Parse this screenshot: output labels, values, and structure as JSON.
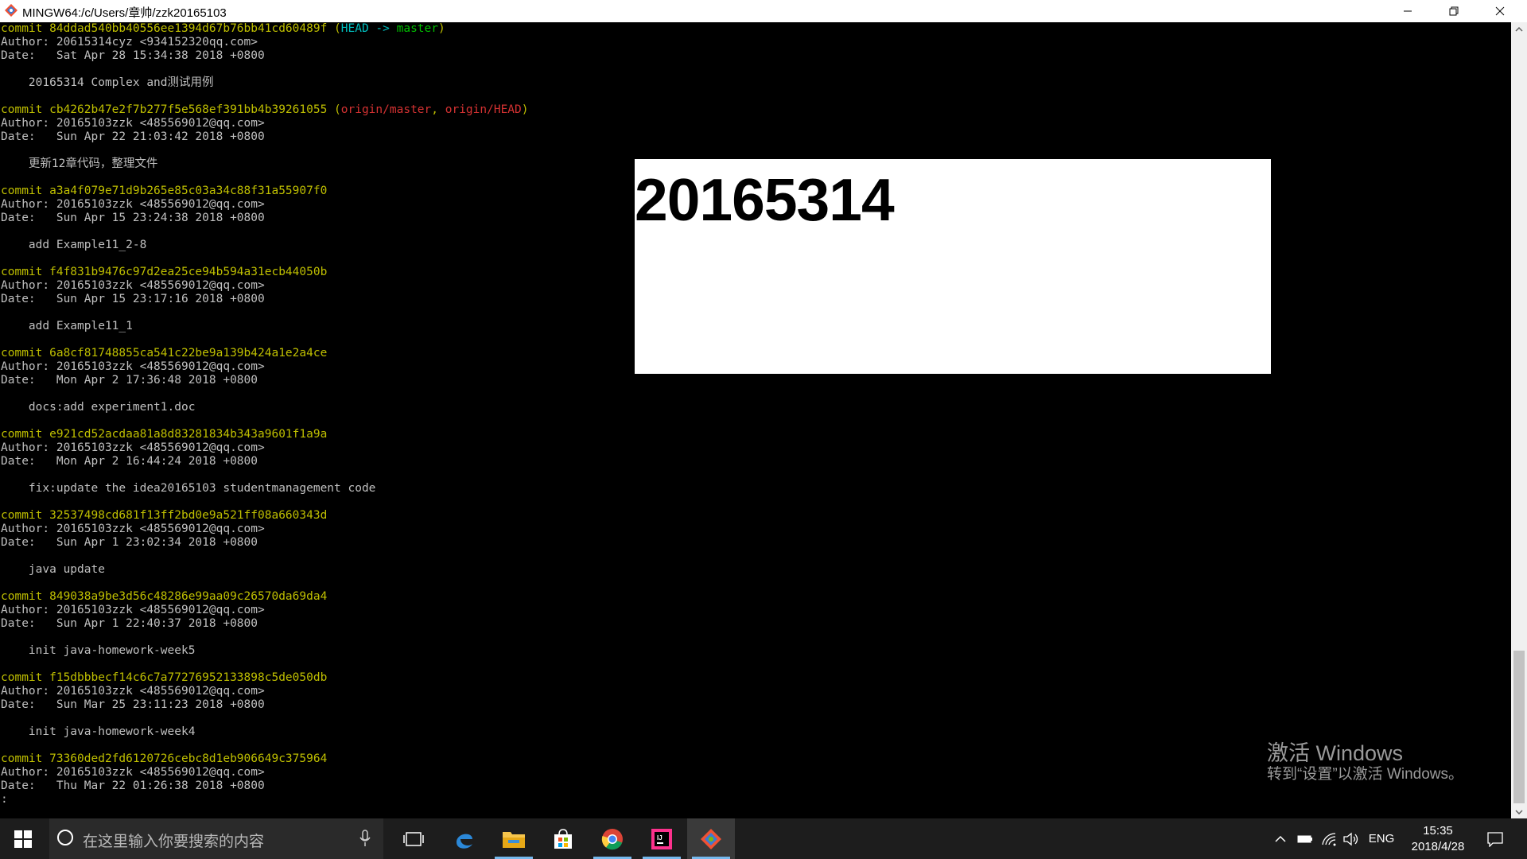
{
  "window": {
    "title": "MINGW64:/c/Users/章帅/zzk20165103",
    "controls": [
      "minimize",
      "restore",
      "close"
    ]
  },
  "terminal": {
    "lines": [
      {
        "segments": [
          {
            "t": "commit 84ddad540bb40556ee1394d67b76bb41cd60489f ",
            "c": "yellow"
          },
          {
            "t": "(",
            "c": "yellow"
          },
          {
            "t": "HEAD -> ",
            "c": "cyan"
          },
          {
            "t": "master",
            "c": "green"
          },
          {
            "t": ")",
            "c": "yellow"
          }
        ]
      },
      {
        "segments": [
          {
            "t": "Author: 20615314cyz <934152320qq.com>",
            "c": "white"
          }
        ]
      },
      {
        "segments": [
          {
            "t": "Date:   Sat Apr 28 15:34:38 2018 +0800",
            "c": "white"
          }
        ]
      },
      {
        "segments": []
      },
      {
        "segments": [
          {
            "t": "    20165314 Complex and测试用例",
            "c": "white"
          }
        ]
      },
      {
        "segments": []
      },
      {
        "segments": [
          {
            "t": "commit cb4262b47e2f7b277f5e568ef391bb4b39261055 ",
            "c": "yellow"
          },
          {
            "t": "(",
            "c": "yellow"
          },
          {
            "t": "origin/master",
            "c": "red"
          },
          {
            "t": ", ",
            "c": "yellow"
          },
          {
            "t": "origin/HEAD",
            "c": "red"
          },
          {
            "t": ")",
            "c": "yellow"
          }
        ]
      },
      {
        "segments": [
          {
            "t": "Author: 20165103zzk <485569012@qq.com>",
            "c": "white"
          }
        ]
      },
      {
        "segments": [
          {
            "t": "Date:   Sun Apr 22 21:03:42 2018 +0800",
            "c": "white"
          }
        ]
      },
      {
        "segments": []
      },
      {
        "segments": [
          {
            "t": "    更新12章代码，整理文件",
            "c": "white"
          }
        ]
      },
      {
        "segments": []
      },
      {
        "segments": [
          {
            "t": "commit a3a4f079e71d9b265e85c03a34c88f31a55907f0",
            "c": "yellow"
          }
        ]
      },
      {
        "segments": [
          {
            "t": "Author: 20165103zzk <485569012@qq.com>",
            "c": "white"
          }
        ]
      },
      {
        "segments": [
          {
            "t": "Date:   Sun Apr 15 23:24:38 2018 +0800",
            "c": "white"
          }
        ]
      },
      {
        "segments": []
      },
      {
        "segments": [
          {
            "t": "    add Example11_2-8",
            "c": "white"
          }
        ]
      },
      {
        "segments": []
      },
      {
        "segments": [
          {
            "t": "commit f4f831b9476c97d2ea25ce94b594a31ecb44050b",
            "c": "yellow"
          }
        ]
      },
      {
        "segments": [
          {
            "t": "Author: 20165103zzk <485569012@qq.com>",
            "c": "white"
          }
        ]
      },
      {
        "segments": [
          {
            "t": "Date:   Sun Apr 15 23:17:16 2018 +0800",
            "c": "white"
          }
        ]
      },
      {
        "segments": []
      },
      {
        "segments": [
          {
            "t": "    add Example11_1",
            "c": "white"
          }
        ]
      },
      {
        "segments": []
      },
      {
        "segments": [
          {
            "t": "commit 6a8cf81748855ca541c22be9a139b424a1e2a4ce",
            "c": "yellow"
          }
        ]
      },
      {
        "segments": [
          {
            "t": "Author: 20165103zzk <485569012@qq.com>",
            "c": "white"
          }
        ]
      },
      {
        "segments": [
          {
            "t": "Date:   Mon Apr 2 17:36:48 2018 +0800",
            "c": "white"
          }
        ]
      },
      {
        "segments": []
      },
      {
        "segments": [
          {
            "t": "    docs:add experiment1.doc",
            "c": "white"
          }
        ]
      },
      {
        "segments": []
      },
      {
        "segments": [
          {
            "t": "commit e921cd52acdaa81a8d83281834b343a9601f1a9a",
            "c": "yellow"
          }
        ]
      },
      {
        "segments": [
          {
            "t": "Author: 20165103zzk <485569012@qq.com>",
            "c": "white"
          }
        ]
      },
      {
        "segments": [
          {
            "t": "Date:   Mon Apr 2 16:44:24 2018 +0800",
            "c": "white"
          }
        ]
      },
      {
        "segments": []
      },
      {
        "segments": [
          {
            "t": "    fix:update the idea20165103 studentmanagement code",
            "c": "white"
          }
        ]
      },
      {
        "segments": []
      },
      {
        "segments": [
          {
            "t": "commit 32537498cd681f13ff2bd0e9a521ff08a660343d",
            "c": "yellow"
          }
        ]
      },
      {
        "segments": [
          {
            "t": "Author: 20165103zzk <485569012@qq.com>",
            "c": "white"
          }
        ]
      },
      {
        "segments": [
          {
            "t": "Date:   Sun Apr 1 23:02:34 2018 +0800",
            "c": "white"
          }
        ]
      },
      {
        "segments": []
      },
      {
        "segments": [
          {
            "t": "    java update",
            "c": "white"
          }
        ]
      },
      {
        "segments": []
      },
      {
        "segments": [
          {
            "t": "commit 849038a9be3d56c48286e99aa09c26570da69da4",
            "c": "yellow"
          }
        ]
      },
      {
        "segments": [
          {
            "t": "Author: 20165103zzk <485569012@qq.com>",
            "c": "white"
          }
        ]
      },
      {
        "segments": [
          {
            "t": "Date:   Sun Apr 1 22:40:37 2018 +0800",
            "c": "white"
          }
        ]
      },
      {
        "segments": []
      },
      {
        "segments": [
          {
            "t": "    init java-homework-week5",
            "c": "white"
          }
        ]
      },
      {
        "segments": []
      },
      {
        "segments": [
          {
            "t": "commit f15dbbbecf14c6c7a77276952133898c5de050db",
            "c": "yellow"
          }
        ]
      },
      {
        "segments": [
          {
            "t": "Author: 20165103zzk <485569012@qq.com>",
            "c": "white"
          }
        ]
      },
      {
        "segments": [
          {
            "t": "Date:   Sun Mar 25 23:11:23 2018 +0800",
            "c": "white"
          }
        ]
      },
      {
        "segments": []
      },
      {
        "segments": [
          {
            "t": "    init java-homework-week4",
            "c": "white"
          }
        ]
      },
      {
        "segments": []
      },
      {
        "segments": [
          {
            "t": "commit 73360ded2fd6120726cebc8d1eb906649c375964",
            "c": "yellow"
          }
        ]
      },
      {
        "segments": [
          {
            "t": "Author: 20165103zzk <485569012@qq.com>",
            "c": "white"
          }
        ]
      },
      {
        "segments": [
          {
            "t": "Date:   Thu Mar 22 01:26:38 2018 +0800",
            "c": "white"
          }
        ]
      },
      {
        "segments": [
          {
            "t": ":",
            "c": "white"
          }
        ]
      }
    ]
  },
  "overlay": {
    "text": "20165314"
  },
  "watermark": {
    "line1": "激活 Windows",
    "line2": "转到“设置”以激活 Windows。"
  },
  "taskbar": {
    "search_placeholder": "在这里输入你要搜索的内容",
    "apps": [
      "task-view-icon",
      "edge-icon",
      "file-explorer-icon",
      "store-icon",
      "chrome-icon",
      "intellij-icon",
      "git-bash-icon"
    ],
    "language": "ENG",
    "time": "15:35",
    "date": "2018/4/28"
  },
  "colors": {
    "yellow": "#bfbf00",
    "cyan": "#00bfbf",
    "green": "#00bf00",
    "red": "#d53232",
    "white": "#c0c0c0",
    "taskbar_bg": "#1d1d1d",
    "accent": "#76b9ed"
  }
}
